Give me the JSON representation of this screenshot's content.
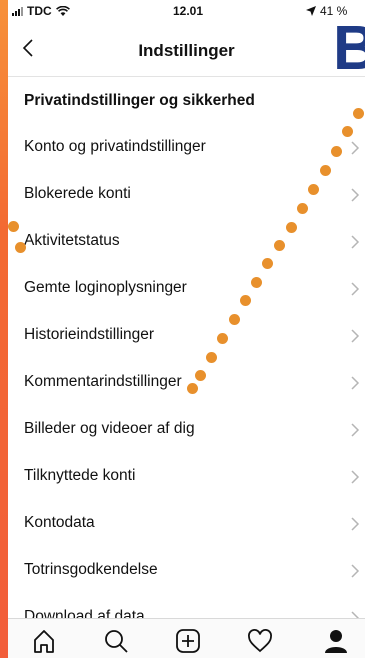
{
  "status": {
    "carrier": "TDC",
    "time": "12.01",
    "battery": "41 %"
  },
  "header": {
    "title": "Indstillinger"
  },
  "section_title": "Privatindstillinger og sikkerhed",
  "items": [
    {
      "label": "Konto og privatindstillinger"
    },
    {
      "label": "Blokerede konti"
    },
    {
      "label": "Aktivitetstatus"
    },
    {
      "label": "Gemte loginoplysninger"
    },
    {
      "label": "Historieindstillinger"
    },
    {
      "label": "Kommentarindstillinger"
    },
    {
      "label": "Billeder og videoer af dig"
    },
    {
      "label": "Tilknyttede konti"
    },
    {
      "label": "Kontodata"
    },
    {
      "label": "Totrinsgodkendelse"
    },
    {
      "label": "Download af data"
    }
  ],
  "tabbar": [
    "home-icon",
    "search-icon",
    "add-post-icon",
    "heart-icon",
    "profile-icon"
  ],
  "decoration": {
    "letter": "B",
    "letter_color": "#1f3b86",
    "dot_color": "#e8902c"
  }
}
